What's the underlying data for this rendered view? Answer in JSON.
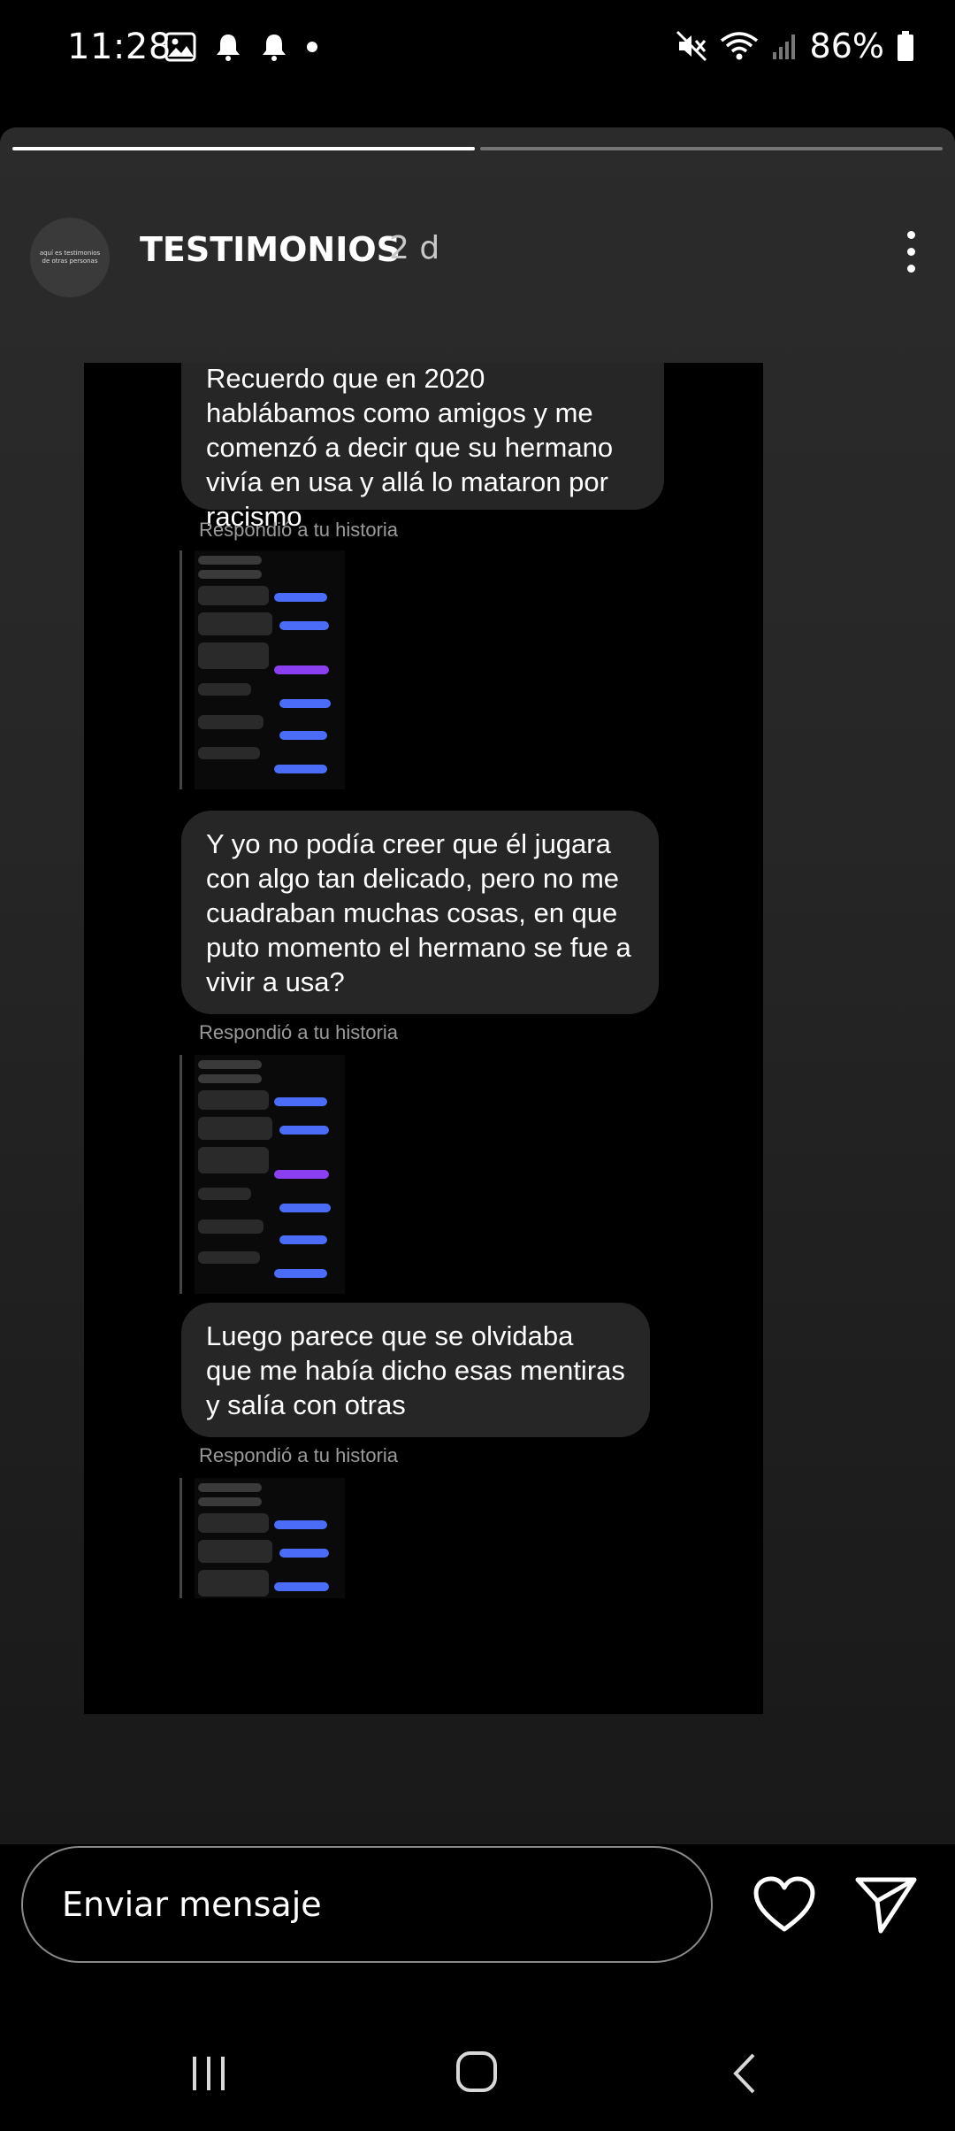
{
  "status_bar": {
    "time": "11:28",
    "battery_percent": "86%",
    "icons": [
      "gallery-icon",
      "notification-bell-icon",
      "notification-bell-icon",
      "dot-icon",
      "mute-icon",
      "wifi-icon",
      "signal-icon",
      "battery-icon"
    ]
  },
  "story": {
    "progress_segments": 2,
    "progress_current": 1,
    "avatar_text": "aquí es testimonios de otras personas",
    "username": "TESTIMONIOS",
    "time_ago": "2 d",
    "messages": [
      {
        "text": "Recuerdo que en 2020 hablábamos como amigos y me comenzó a decir que su hermano vivía en usa y allá lo mataron por racismo",
        "replied_label": "Respondió a tu historia"
      },
      {
        "text": "Y yo no podía creer que él jugara con algo tan delicado, pero no me cuadraban muchas cosas, en que puto momento el hermano se fue a vivir a usa?",
        "replied_label": "Respondió a tu historia"
      },
      {
        "text": "Luego parece que se olvidaba que me había dicho esas mentiras y salía con otras",
        "replied_label": "Respondió a tu historia"
      }
    ]
  },
  "composer": {
    "placeholder": "Enviar mensaje"
  },
  "colors": {
    "bubble": "#262626",
    "background": "#000000",
    "accent_blue": "#4a6cf7",
    "accent_purple": "#8a3ff0"
  }
}
